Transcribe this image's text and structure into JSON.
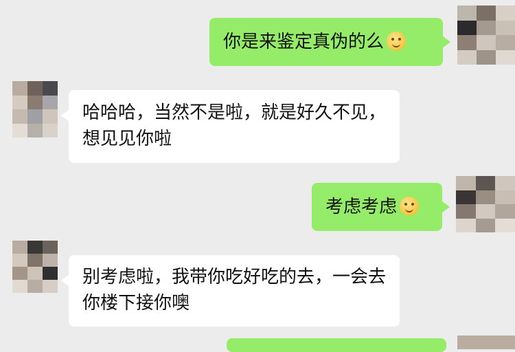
{
  "messages": [
    {
      "side": "out",
      "text": "你是来鉴定真伪的么",
      "emoji": "smile-blush-emoji"
    },
    {
      "side": "in",
      "text": "哈哈哈，当然不是啦，就是好久不见，想见见你啦"
    },
    {
      "side": "out",
      "text": "考虑考虑",
      "emoji": "smile-blush-emoji"
    },
    {
      "side": "in",
      "text": "别考虑啦，我带你吃好吃的去，一会去你楼下接你噢"
    }
  ],
  "colors": {
    "background": "#ececec",
    "outgoing_bubble": "#95ec69",
    "incoming_bubble": "#ffffff"
  }
}
